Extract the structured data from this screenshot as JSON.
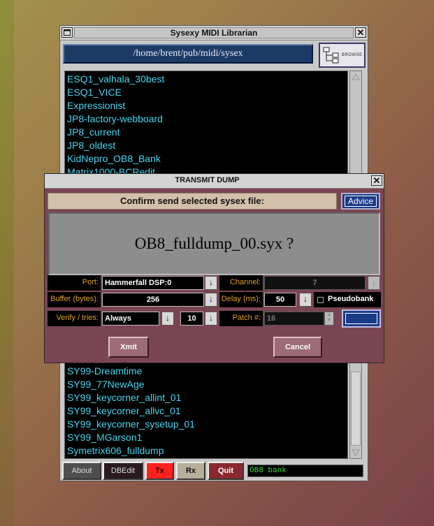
{
  "main_window": {
    "title": "Sysexy MIDI Librarian",
    "path": "/home/brent/pub/midi/sysex",
    "browse_label": "BROWSE",
    "files_top": [
      "ESQ1_valhala_30best",
      "ESQ1_VICE",
      "Expressionist",
      "JP8-factory-webboard",
      "JP8_current",
      "JP8_oldest",
      "KidNepro_OB8_Bank",
      "Matrix1000-BCRedit"
    ],
    "files_bottom": [
      "SY99-Dreamtime",
      "SY99_77NewAge",
      "SY99_keycorner_allint_01",
      "SY99_keycorner_allvc_01",
      "SY99_keycorner_sysetup_01",
      "SY99_MGarson1",
      "Symetrix606_fulldump"
    ],
    "buttons": {
      "about": "About",
      "dbedit": "DBEdit",
      "tx": "Tx",
      "rx": "Rx",
      "quit": "Quit"
    },
    "status_text": "OB8 bank"
  },
  "dialog": {
    "title": "TRANSMIT DUMP",
    "confirm_text": "Confirm send selected sysex file:",
    "advice_label": "Advice",
    "filename": "OB8_fulldump_00.syx ?",
    "port_label": "Port:",
    "port_value": "Hammerfall DSP:0",
    "channel_label": "Channel:",
    "channel_value": "7",
    "buffer_label": "Buffer (bytes):",
    "buffer_value": "256",
    "delay_label": "Delay (ms):",
    "delay_value": "50",
    "pseudobank_label": "Pseudobank",
    "verify_label": "Verify / tries:",
    "verify_value": "Always",
    "tries_value": "10",
    "patch_label": "Patch #:",
    "patch_value": "16",
    "xmit_label": "Xmit",
    "cancel_label": "Cancel"
  },
  "colors": {
    "list_text": "#43d6f0",
    "label_text": "#e0a020",
    "dialog_bg": "#7a4553",
    "path_bg": "#1b3a66",
    "status_text": "#3ddc3d"
  }
}
